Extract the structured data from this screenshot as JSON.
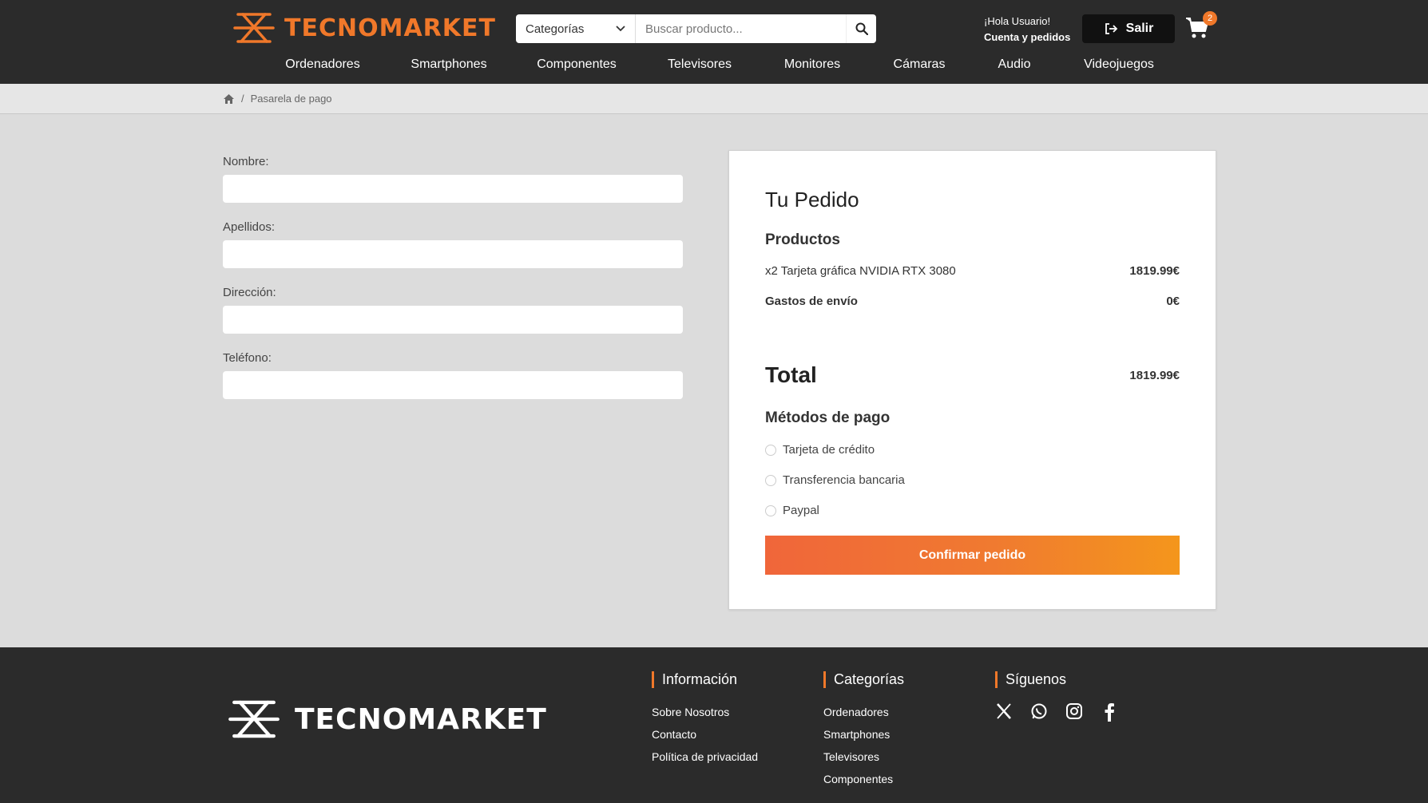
{
  "brand": {
    "name": "TECNOMARKET",
    "accent": "#f0782a"
  },
  "header": {
    "category_select": "Categorías",
    "search_placeholder": "Buscar producto...",
    "greeting": "¡Hola Usuario!",
    "account_link": "Cuenta y pedidos",
    "logout_label": "Salir",
    "cart_count": "2"
  },
  "nav": [
    "Ordenadores",
    "Smartphones",
    "Componentes",
    "Televisores",
    "Monitores",
    "Cámaras",
    "Audio",
    "Videojuegos"
  ],
  "breadcrumb": {
    "current": "Pasarela de pago"
  },
  "form": {
    "name_label": "Nombre:",
    "surname_label": "Apellidos:",
    "address_label": "Dirección:",
    "phone_label": "Teléfono:"
  },
  "order": {
    "title": "Tu Pedido",
    "products_heading": "Productos",
    "item_label": "x2 Tarjeta gráfica NVIDIA RTX 3080",
    "item_price": "1819.99€",
    "shipping_label": "Gastos de envío",
    "shipping_price": "0€",
    "total_label": "Total",
    "total_value": "1819.99€",
    "payment_heading": "Métodos de pago",
    "payment_methods": [
      "Tarjeta de crédito",
      "Transferencia bancaria",
      "Paypal"
    ],
    "confirm_label": "Confirmar pedido"
  },
  "footer": {
    "info_heading": "Información",
    "info_links": [
      "Sobre Nosotros",
      "Contacto",
      "Política de privacidad"
    ],
    "categories_heading": "Categorías",
    "categories_links": [
      "Ordenadores",
      "Smartphones",
      "Televisores",
      "Componentes"
    ],
    "social_heading": "Síguenos",
    "social_icons": [
      "x-icon",
      "whatsapp-icon",
      "instagram-icon",
      "facebook-icon"
    ]
  }
}
